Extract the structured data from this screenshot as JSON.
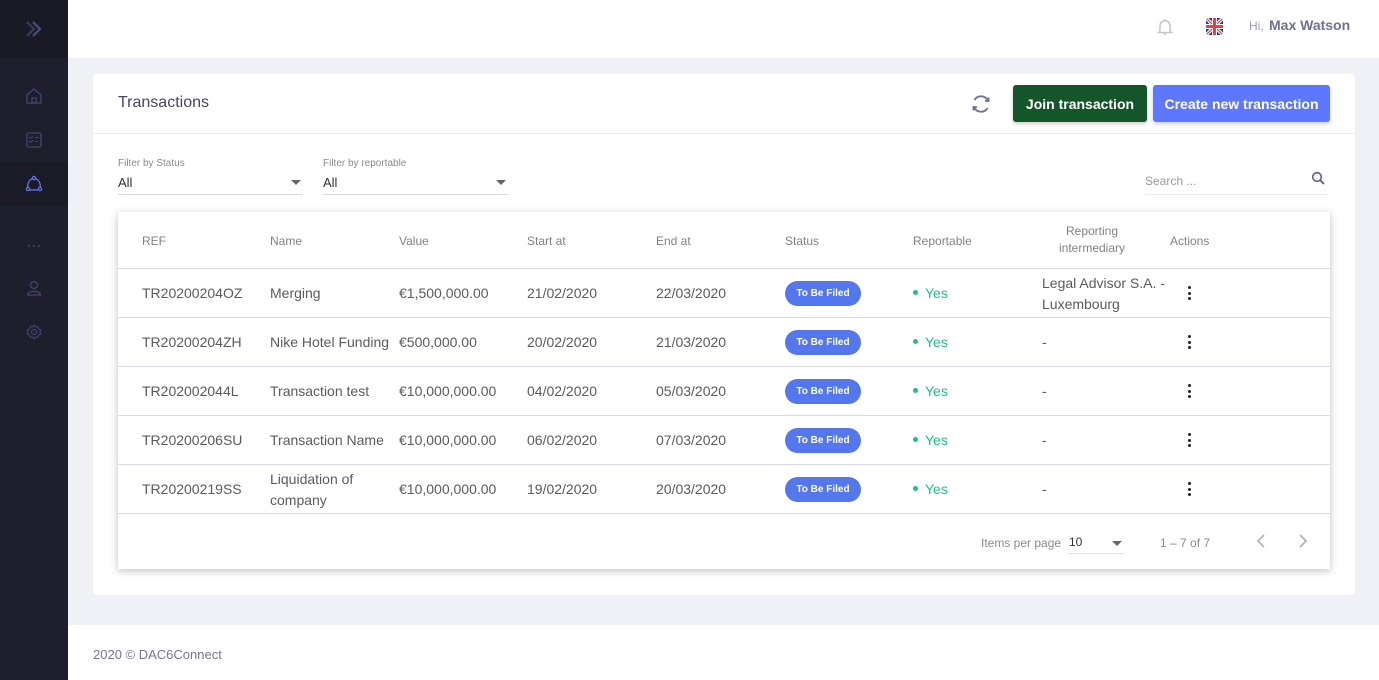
{
  "sidebar": {
    "items": [
      {
        "name": "home",
        "icon": "home-icon"
      },
      {
        "name": "tasks",
        "icon": "checklist-icon"
      },
      {
        "name": "transactions",
        "icon": "network-icon",
        "active": true
      },
      {
        "name": "more",
        "icon": "more-dots-icon"
      },
      {
        "name": "profile",
        "icon": "user-icon"
      },
      {
        "name": "settings",
        "icon": "gear-icon"
      }
    ]
  },
  "header": {
    "greeting": "Hi,",
    "user_name": "Max Watson",
    "language": "en-GB"
  },
  "card": {
    "title": "Transactions",
    "join_label": "Join transaction",
    "create_label": "Create new transaction"
  },
  "filters": {
    "status": {
      "label": "Filter by Status",
      "value": "All"
    },
    "reportable": {
      "label": "Filter by reportable",
      "value": "All"
    },
    "search_placeholder": "Search ..."
  },
  "table": {
    "columns": [
      "REF",
      "Name",
      "Value",
      "Start at",
      "End at",
      "Status",
      "Reportable",
      "Reporting intermediary",
      "Actions"
    ],
    "rows": [
      {
        "ref": "TR20200204OZ",
        "name": "Merging",
        "value": "€1,500,000.00",
        "start": "21/02/2020",
        "end": "22/03/2020",
        "status": "To Be Filed",
        "reportable": "Yes",
        "intermediary": "Legal Advisor S.A. - Luxembourg"
      },
      {
        "ref": "TR20200204ZH",
        "name": "Nike Hotel Funding",
        "value": "€500,000.00",
        "start": "20/02/2020",
        "end": "21/03/2020",
        "status": "To Be Filed",
        "reportable": "Yes",
        "intermediary": "-"
      },
      {
        "ref": "TR202002044L",
        "name": "Transaction test",
        "value": "€10,000,000.00",
        "start": "04/02/2020",
        "end": "05/03/2020",
        "status": "To Be Filed",
        "reportable": "Yes",
        "intermediary": "-"
      },
      {
        "ref": "TR20200206SU",
        "name": "Transaction Name",
        "value": "€10,000,000.00",
        "start": "06/02/2020",
        "end": "07/03/2020",
        "status": "To Be Filed",
        "reportable": "Yes",
        "intermediary": "-"
      },
      {
        "ref": "TR20200219SS",
        "name": "Liquidation of company",
        "value": "€10,000,000.00",
        "start": "19/02/2020",
        "end": "20/03/2020",
        "status": "To Be Filed",
        "reportable": "Yes",
        "intermediary": "-"
      }
    ]
  },
  "paginator": {
    "items_per_page_label": "Items per page",
    "items_per_page": "10",
    "range": "1 – 7 of 7"
  },
  "footer": {
    "text": "2020 © DAC6Connect"
  },
  "colors": {
    "sidebar_bg": "#1e1e2d",
    "accent": "#5d78ff",
    "join_button": "#15552a",
    "status_badge": "#5577ee",
    "reportable_yes": "#1dbf8b"
  }
}
